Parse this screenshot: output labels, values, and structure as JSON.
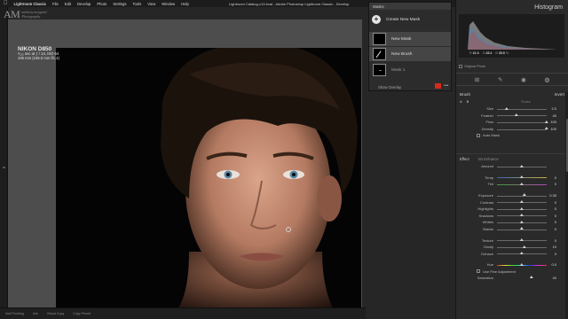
{
  "menubar": {
    "items": [
      "Lightroom Classic",
      "File",
      "Edit",
      "Develop",
      "Photo",
      "Settings",
      "Tools",
      "View",
      "Window",
      "Help"
    ],
    "window_title": "Lightroom Catalog-v13.lrcat - Adobe Photoshop Lightroom Classic - Develop"
  },
  "identity": {
    "logo": "AM",
    "line1": "anthony morganti",
    "line2": "Photography"
  },
  "photo_info": {
    "camera": "NIKON D850",
    "exposure": "¹⁄₁₂₅ sec at ƒ / 14, ISO 64",
    "lens": "105 mm (105.0 mm f/1.4)"
  },
  "bottom_strip": [
    "Soft Proofing",
    "Info",
    "Virtual Copy",
    "Copy Preset"
  ],
  "masks": {
    "title": "Masks",
    "create_label": "Create New Mask",
    "items": [
      {
        "label": "New Mask",
        "selected": true
      },
      {
        "label": "New Brush",
        "selected": true
      },
      {
        "label": "Mask 1",
        "selected": false
      }
    ],
    "show_overlay": "Show Overlay",
    "overlay_color": "#d42a1c",
    "more": "•••"
  },
  "panel": {
    "title": "Histogram",
    "histogram": {
      "r_label": "R",
      "r": "21.0",
      "g_label": "G",
      "g": "25.2",
      "b_label": "B",
      "b": "25.5",
      "unit": "%"
    },
    "original_photo": "Original Photo",
    "tools": [
      "crop-overlay-icon",
      "healing-icon",
      "red-eye-icon",
      "masking-icon"
    ]
  },
  "brush": {
    "title": "Brush",
    "invert": "Invert",
    "tab_a": "A",
    "tab_b": "B",
    "erase": "Erase",
    "sliders": [
      {
        "label": "Size",
        "value": "2.0",
        "pos": 0.2
      },
      {
        "label": "Feather",
        "value": "40",
        "pos": 0.4
      },
      {
        "label": "Flow",
        "value": "100",
        "pos": 1.0
      },
      {
        "label": "Density",
        "value": "100",
        "pos": 1.0
      }
    ],
    "auto_mask": "Auto Mask"
  },
  "effect": {
    "label": "Effect",
    "preset": "No Enhance",
    "amount": {
      "label": "Amount",
      "value": "",
      "pos": 0.5
    },
    "groups": [
      [
        {
          "label": "Temp",
          "value": "0",
          "pos": 0.5,
          "grad": "temp"
        },
        {
          "label": "Tint",
          "value": "0",
          "pos": 0.5,
          "grad": "tint"
        }
      ],
      [
        {
          "label": "Exposure",
          "value": "0.35",
          "pos": 0.55
        },
        {
          "label": "Contrast",
          "value": "0",
          "pos": 0.5
        },
        {
          "label": "Highlights",
          "value": "0",
          "pos": 0.5
        },
        {
          "label": "Shadows",
          "value": "0",
          "pos": 0.5
        },
        {
          "label": "Whites",
          "value": "0",
          "pos": 0.5
        },
        {
          "label": "Blacks",
          "value": "0",
          "pos": 0.5
        }
      ],
      [
        {
          "label": "Texture",
          "value": "0",
          "pos": 0.5
        },
        {
          "label": "Clarity",
          "value": "10",
          "pos": 0.55
        },
        {
          "label": "Dehaze",
          "value": "0",
          "pos": 0.5
        }
      ]
    ],
    "hue": {
      "label": "Hue",
      "value": "0.0",
      "pos": 0.5
    },
    "fine_adjust": "Use Fine Adjustment",
    "saturation": {
      "label": "Saturation",
      "value": "40",
      "pos": 0.7
    }
  }
}
